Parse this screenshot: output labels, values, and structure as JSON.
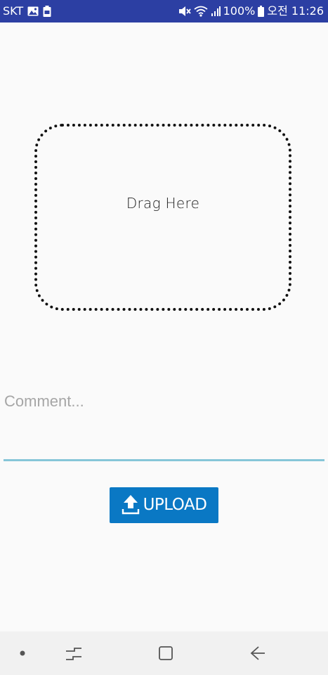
{
  "status_bar": {
    "carrier": "SKT",
    "battery_percent": "100%",
    "time": "오전 11:26",
    "icons": [
      "image-icon",
      "battery-saver-icon",
      "mute-icon",
      "wifi-icon",
      "signal-icon",
      "battery-icon"
    ]
  },
  "drop_zone": {
    "label": "Drag Here"
  },
  "comment": {
    "placeholder": "Comment...",
    "value": ""
  },
  "upload": {
    "label": "UPLOAD",
    "icon": "upload-icon"
  },
  "nav_bar": {
    "items": [
      "dot-indicator-icon",
      "recent-apps-icon",
      "home-icon",
      "back-icon"
    ]
  },
  "colors": {
    "status_bar": "#2c3fa3",
    "upload_button": "#0a78c4",
    "input_underline": "#86c6d8",
    "background": "#fafafa",
    "nav_bar": "#f1f1f1"
  }
}
